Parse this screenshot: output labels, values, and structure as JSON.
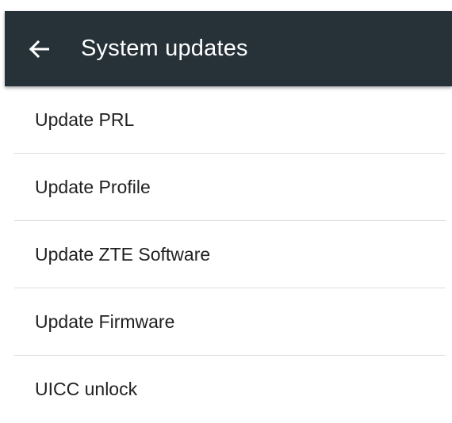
{
  "app_bar": {
    "title": "System updates",
    "back_icon": "arrow-back-icon",
    "background_color": "#263238",
    "title_color": "#ffffff"
  },
  "items": [
    {
      "label": "Update PRL"
    },
    {
      "label": "Update Profile"
    },
    {
      "label": "Update ZTE Software"
    },
    {
      "label": "Update Firmware"
    },
    {
      "label": "UICC unlock"
    }
  ]
}
